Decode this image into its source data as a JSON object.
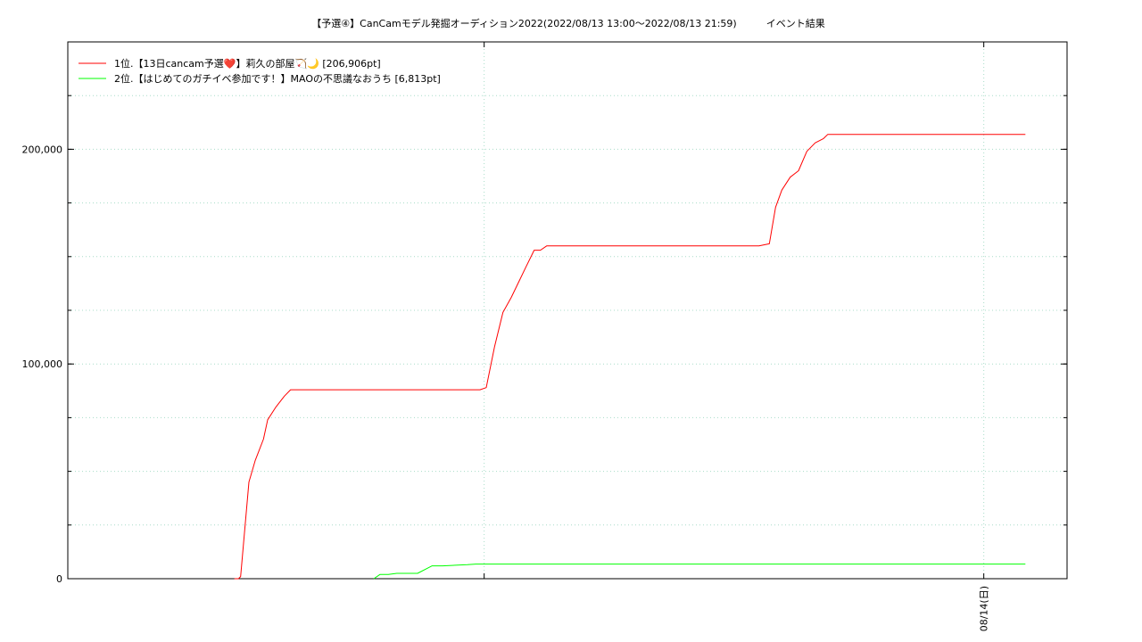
{
  "chart_data": {
    "type": "line",
    "title": "【予選④】CanCamモデル発掘オーディション2022(2022/08/13 13:00～2022/08/13 21:59)　　　イベント結果",
    "xlabel": "",
    "ylabel": "",
    "x_unit": "hours after 2022/08/13 00:00",
    "xlim": [
      10.0,
      34.0
    ],
    "ylim": [
      0,
      250000
    ],
    "grid": true,
    "legend_position": "top-left",
    "x_ticks": [
      {
        "x": 20.0,
        "label": ""
      },
      {
        "x": 32.0,
        "label": "08/14(日)"
      }
    ],
    "y_ticks": [
      {
        "y": 0,
        "label": "0"
      },
      {
        "y": 100000,
        "label": "100,000"
      },
      {
        "y": 200000,
        "label": "200,000"
      }
    ],
    "series": [
      {
        "name": "1位.【13日cancam予選❤️】莉久の部屋🏹🌙 [206,906pt]",
        "color": "#ff0000",
        "points": [
          [
            14.0,
            0
          ],
          [
            14.1,
            0
          ],
          [
            14.15,
            1000
          ],
          [
            14.35,
            45000
          ],
          [
            14.5,
            55000
          ],
          [
            14.7,
            65000
          ],
          [
            14.8,
            74000
          ],
          [
            15.0,
            80000
          ],
          [
            15.2,
            85000
          ],
          [
            15.35,
            88000
          ],
          [
            19.9,
            88000
          ],
          [
            20.05,
            89000
          ],
          [
            20.25,
            108000
          ],
          [
            20.45,
            124000
          ],
          [
            20.65,
            131000
          ],
          [
            20.8,
            137000
          ],
          [
            21.0,
            145000
          ],
          [
            21.2,
            153000
          ],
          [
            21.35,
            153000
          ],
          [
            21.5,
            155000
          ],
          [
            26.6,
            155000
          ],
          [
            26.85,
            156000
          ],
          [
            27.0,
            173000
          ],
          [
            27.15,
            181000
          ],
          [
            27.35,
            187000
          ],
          [
            27.55,
            190000
          ],
          [
            27.75,
            199000
          ],
          [
            27.95,
            203000
          ],
          [
            28.15,
            205000
          ],
          [
            28.25,
            206906
          ],
          [
            33.0,
            206906
          ]
        ]
      },
      {
        "name": "2位.【はじめてのガチイベ参加です！】MAOの不思議なおうち [6,813pt]",
        "color": "#00ff00",
        "points": [
          [
            17.35,
            0
          ],
          [
            17.5,
            2000
          ],
          [
            17.7,
            2000
          ],
          [
            17.9,
            2500
          ],
          [
            18.4,
            2500
          ],
          [
            18.75,
            6000
          ],
          [
            19.0,
            6000
          ],
          [
            19.6,
            6500
          ],
          [
            19.8,
            6813
          ],
          [
            33.0,
            6813
          ]
        ]
      }
    ]
  }
}
